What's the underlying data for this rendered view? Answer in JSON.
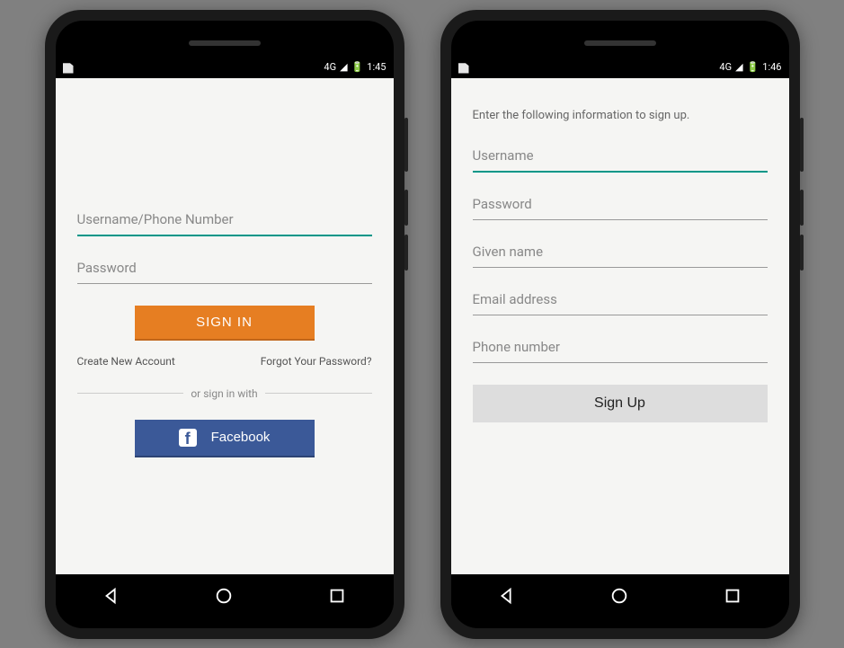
{
  "phone_left": {
    "status": {
      "network": "4G",
      "time": "1:45"
    },
    "signin": {
      "username_placeholder": "Username/Phone Number",
      "password_placeholder": "Password",
      "signin_button": "SIGN IN",
      "create_account_link": "Create New Account",
      "forgot_password_link": "Forgot Your Password?",
      "divider_text": "or sign in with",
      "facebook_button": "Facebook"
    }
  },
  "phone_right": {
    "status": {
      "network": "4G",
      "time": "1:46"
    },
    "signup": {
      "instruction": "Enter the following information to sign up.",
      "username_placeholder": "Username",
      "password_placeholder": "Password",
      "given_name_placeholder": "Given name",
      "email_placeholder": "Email address",
      "phone_placeholder": "Phone number",
      "signup_button": "Sign Up"
    }
  }
}
